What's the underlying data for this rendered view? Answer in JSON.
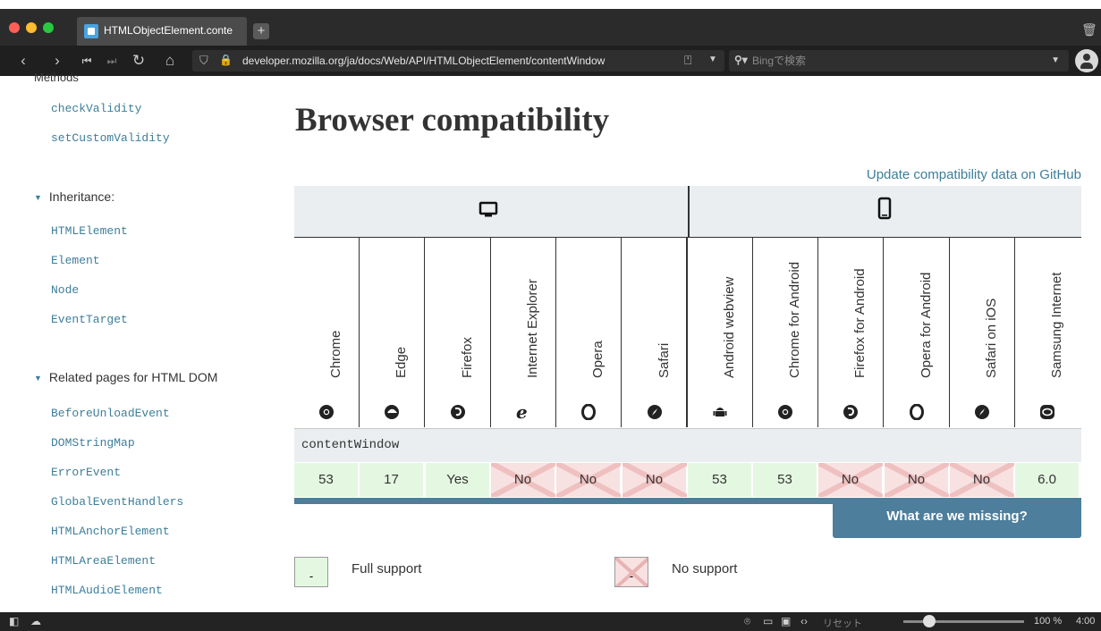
{
  "browser": {
    "tab_title": "HTMLObjectElement.conte",
    "url": "developer.mozilla.org/ja/docs/Web/API/HTMLObjectElement/contentWindow",
    "search_placeholder": "Bingで検索"
  },
  "sidebar": {
    "cut_heading": "Methods",
    "methods": [
      "checkValidity",
      "setCustomValidity"
    ],
    "inheritance_heading": "Inheritance:",
    "inheritance": [
      "HTMLElement",
      "Element",
      "Node",
      "EventTarget"
    ],
    "related_heading": "Related pages for HTML DOM",
    "related": [
      "BeforeUnloadEvent",
      "DOMStringMap",
      "ErrorEvent",
      "GlobalEventHandlers",
      "HTMLAnchorElement",
      "HTMLAreaElement",
      "HTMLAudioElement"
    ]
  },
  "main": {
    "title": "Browser compatibility",
    "github_link": "Update compatibility data on GitHub",
    "feature": "contentWindow",
    "browsers": [
      {
        "name": "Chrome",
        "icon": "chrome-icon",
        "support": "53",
        "supported": true
      },
      {
        "name": "Edge",
        "icon": "edge-icon",
        "support": "17",
        "supported": true
      },
      {
        "name": "Firefox",
        "icon": "firefox-icon",
        "support": "Yes",
        "supported": true
      },
      {
        "name": "Internet Explorer",
        "icon": "ie-icon",
        "support": "No",
        "supported": false
      },
      {
        "name": "Opera",
        "icon": "opera-icon",
        "support": "No",
        "supported": false
      },
      {
        "name": "Safari",
        "icon": "safari-icon",
        "support": "No",
        "supported": false
      },
      {
        "name": "Android webview",
        "icon": "android-icon",
        "support": "53",
        "supported": true
      },
      {
        "name": "Chrome for Android",
        "icon": "chrome-icon",
        "support": "53",
        "supported": true
      },
      {
        "name": "Firefox for Android",
        "icon": "firefox-icon",
        "support": "No",
        "supported": false
      },
      {
        "name": "Opera for Android",
        "icon": "opera-icon",
        "support": "No",
        "supported": false
      },
      {
        "name": "Safari on iOS",
        "icon": "safari-icon",
        "support": "No",
        "supported": false
      },
      {
        "name": "Samsung Internet",
        "icon": "samsung-icon",
        "support": "6.0",
        "supported": true
      }
    ],
    "missing_button": "What are we missing?",
    "legend": {
      "full_support": "Full support",
      "no_support": "No support",
      "box_mark": "-"
    }
  },
  "statusbar": {
    "reset_label": "リセット",
    "zoom": "100 %",
    "time": "4:00"
  },
  "colors": {
    "link": "#3d7e9a",
    "yes_bg": "#e4f8e1",
    "no_bg": "#f8e1e1",
    "accent_blue": "#4d7e9b"
  }
}
